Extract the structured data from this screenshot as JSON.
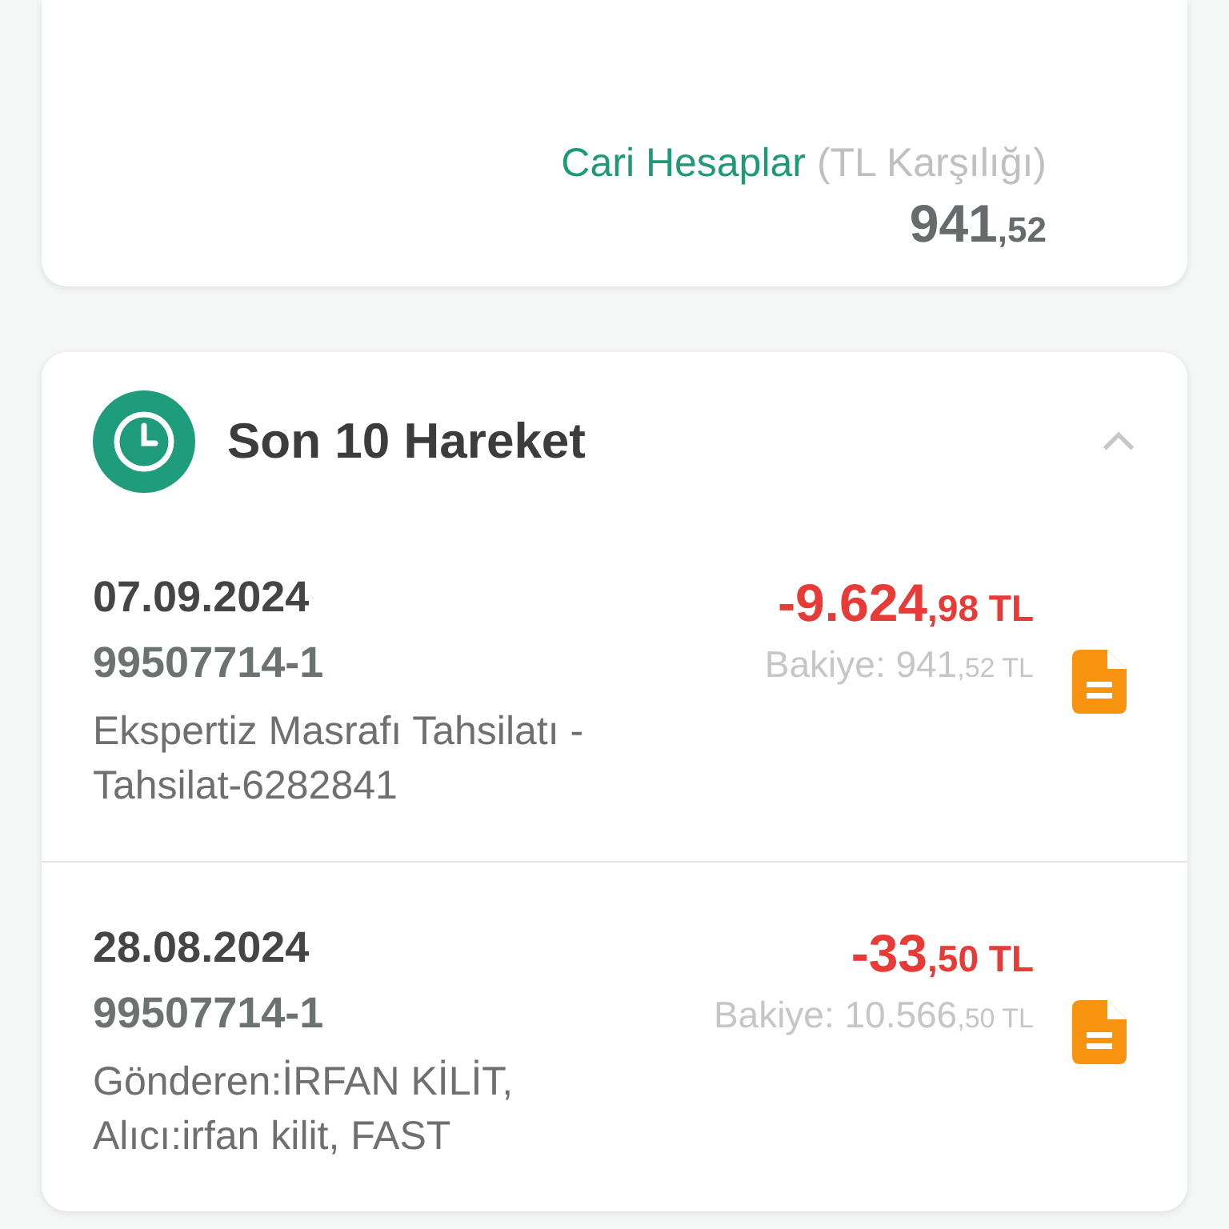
{
  "account_summary": {
    "label": "Cari Hesaplar",
    "note": "(TL Karşılığı)",
    "amount_int": "941",
    "amount_dec": ",52"
  },
  "recent": {
    "title": "Son 10 Hareket",
    "expanded": true,
    "transactions": [
      {
        "date": "07.09.2024",
        "account": "99507714-1",
        "description": "Ekspertiz Masrafı Tahsilatı -Tahsilat-6282841",
        "amount_int": "-9.624",
        "amount_dec": ",98 TL",
        "balance_label": "Bakiye:",
        "balance_int": "941",
        "balance_dec": ",52 TL"
      },
      {
        "date": "28.08.2024",
        "account": "99507714-1",
        "description": "Gönderen:İRFAN KİLİT, Alıcı:irfan kilit, FAST",
        "amount_int": "-33",
        "amount_dec": ",50 TL",
        "balance_label": "Bakiye:",
        "balance_int": "10.566",
        "balance_dec": ",50 TL"
      }
    ]
  }
}
